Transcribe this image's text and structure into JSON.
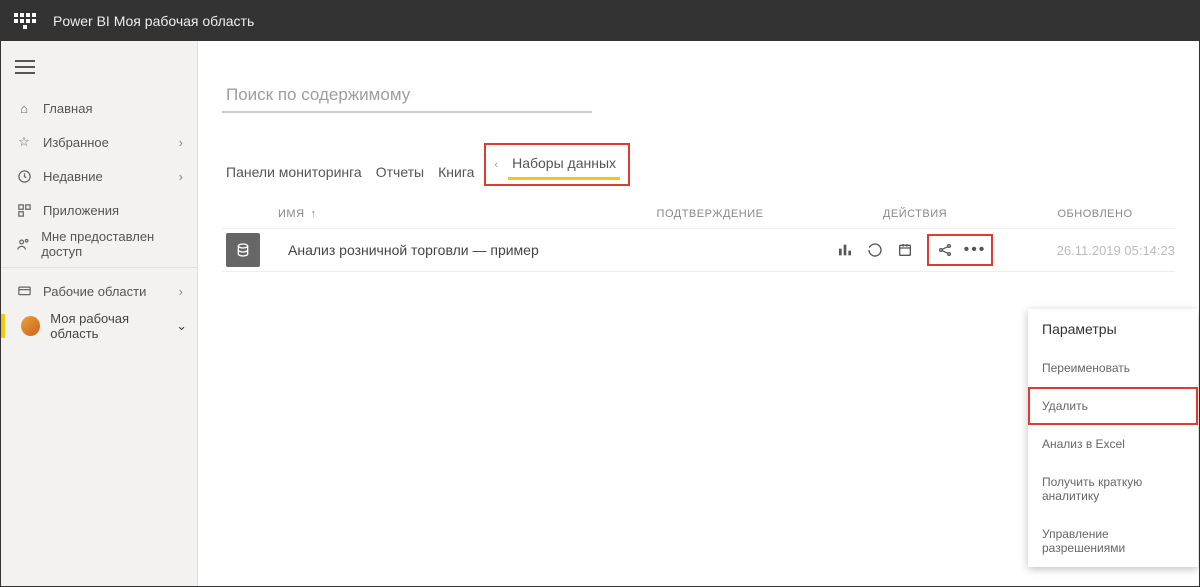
{
  "header": {
    "app": "Power BI",
    "workspace": "Моя рабочая область"
  },
  "sidebar": {
    "home": "Главная",
    "favorites": "Избранное",
    "recent": "Недавние",
    "apps": "Приложения",
    "shared": "Мне предоставлен доступ",
    "workspaces": "Рабочие области",
    "current": "Моя рабочая область"
  },
  "main": {
    "search_placeholder": "Поиск по содержимому",
    "tabs": {
      "dashboards": "Панели мониторинга",
      "reports": "Отчеты",
      "workbooks": "Книга",
      "datasets": "Наборы данных"
    },
    "columns": {
      "name": "Имя",
      "endorsement": "ПОДТВЕРЖДЕНИЕ",
      "actions": "ДЕЙСТВИЯ",
      "updated": "ОБНОВЛЕНО"
    },
    "row": {
      "name": "Анализ розничной торговли — пример",
      "updated": "26.11.2019 05:14:23"
    }
  },
  "menu": {
    "title": "Параметры",
    "rename": "Переименовать",
    "delete": "Удалить",
    "analyze": "Анализ в Excel",
    "insights": "Получить краткую аналитику",
    "permissions": "Управление разрешениями"
  }
}
